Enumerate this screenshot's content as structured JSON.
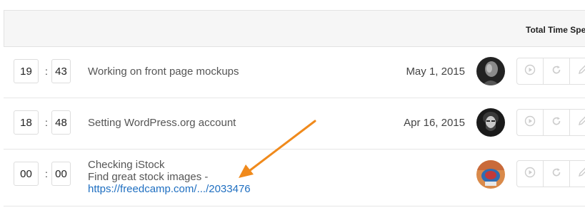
{
  "header": {
    "title": "Total Time Spe"
  },
  "rows": [
    {
      "hours": "19",
      "separator": ":",
      "minutes": "43",
      "description": "Working on front page mockups",
      "date": "May 1, 2015",
      "avatar": "user-avatar-bw"
    },
    {
      "hours": "18",
      "separator": ":",
      "minutes": "48",
      "description": "Setting WordPress.org account",
      "date": "Apr 16, 2015",
      "avatar": "user-avatar-bearded"
    },
    {
      "hours": "00",
      "separator": ":",
      "minutes": "00",
      "title": "Checking iStock",
      "description": "Find great stock images -",
      "link": "https://freedcamp.com/.../2033476",
      "date": "",
      "avatar": "user-avatar-color"
    }
  ],
  "icons": {
    "play": "play-icon",
    "reset": "refresh-icon",
    "edit": "pencil-icon",
    "arrow": "orange-arrow-annotation"
  },
  "colors": {
    "link": "#1f6fc1",
    "arrow": "#f08a1c",
    "header_bg": "#f6f6f6"
  }
}
